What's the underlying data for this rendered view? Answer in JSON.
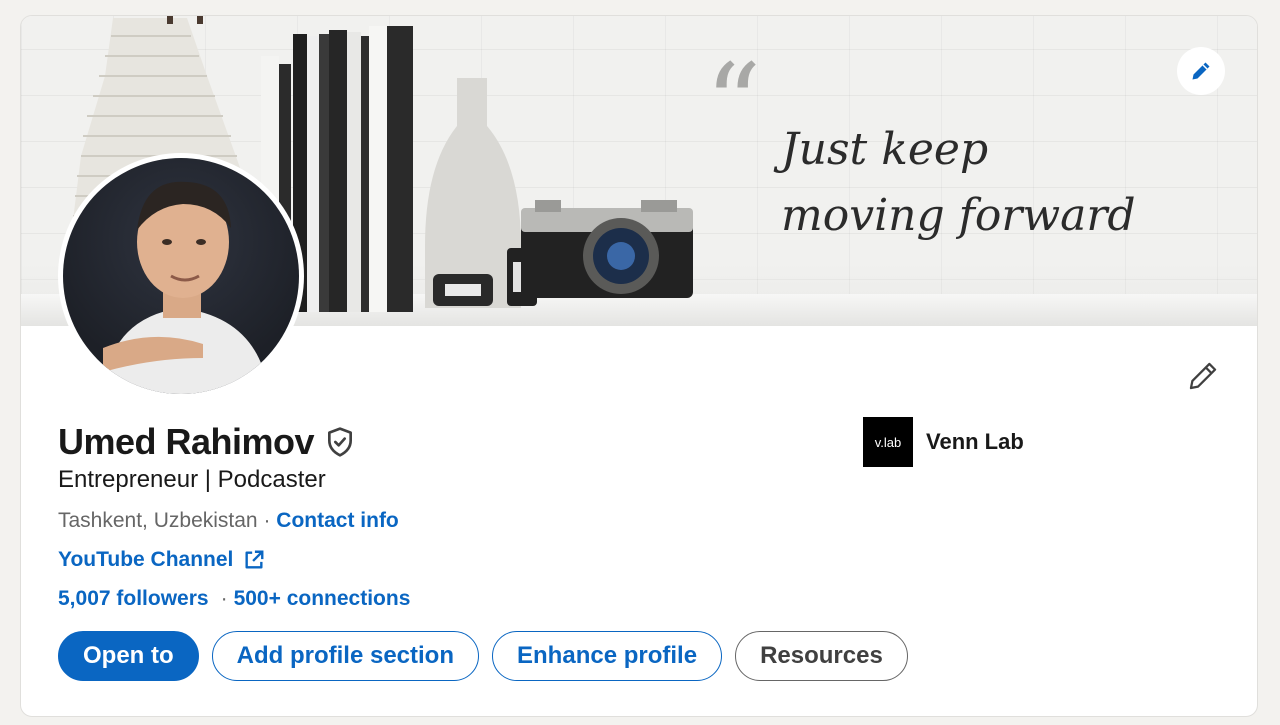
{
  "banner": {
    "quote_line1": "Just keep",
    "quote_line2": "moving forward",
    "edit_icon": "pencil-icon"
  },
  "profile": {
    "name": "Umed Rahimov",
    "verified_icon": "verified-shield-icon",
    "headline": "Entrepreneur | Podcaster",
    "location": "Tashkent, Uzbekistan",
    "location_separator": " · ",
    "contact_info_label": "Contact info",
    "website_label": "YouTube Channel",
    "website_icon": "external-link-icon",
    "followers": "5,007 followers",
    "stats_separator": "·",
    "connections": "500+ connections",
    "edit_icon": "pencil-icon"
  },
  "company": {
    "logo_text": "v.lab",
    "name": "Venn Lab"
  },
  "actions": {
    "open_to": "Open to",
    "add_section": "Add profile section",
    "enhance": "Enhance profile",
    "resources": "Resources"
  },
  "colors": {
    "accent": "#0a66c2",
    "text": "#191919",
    "muted": "#666666",
    "page_bg": "#f3f2ef"
  }
}
